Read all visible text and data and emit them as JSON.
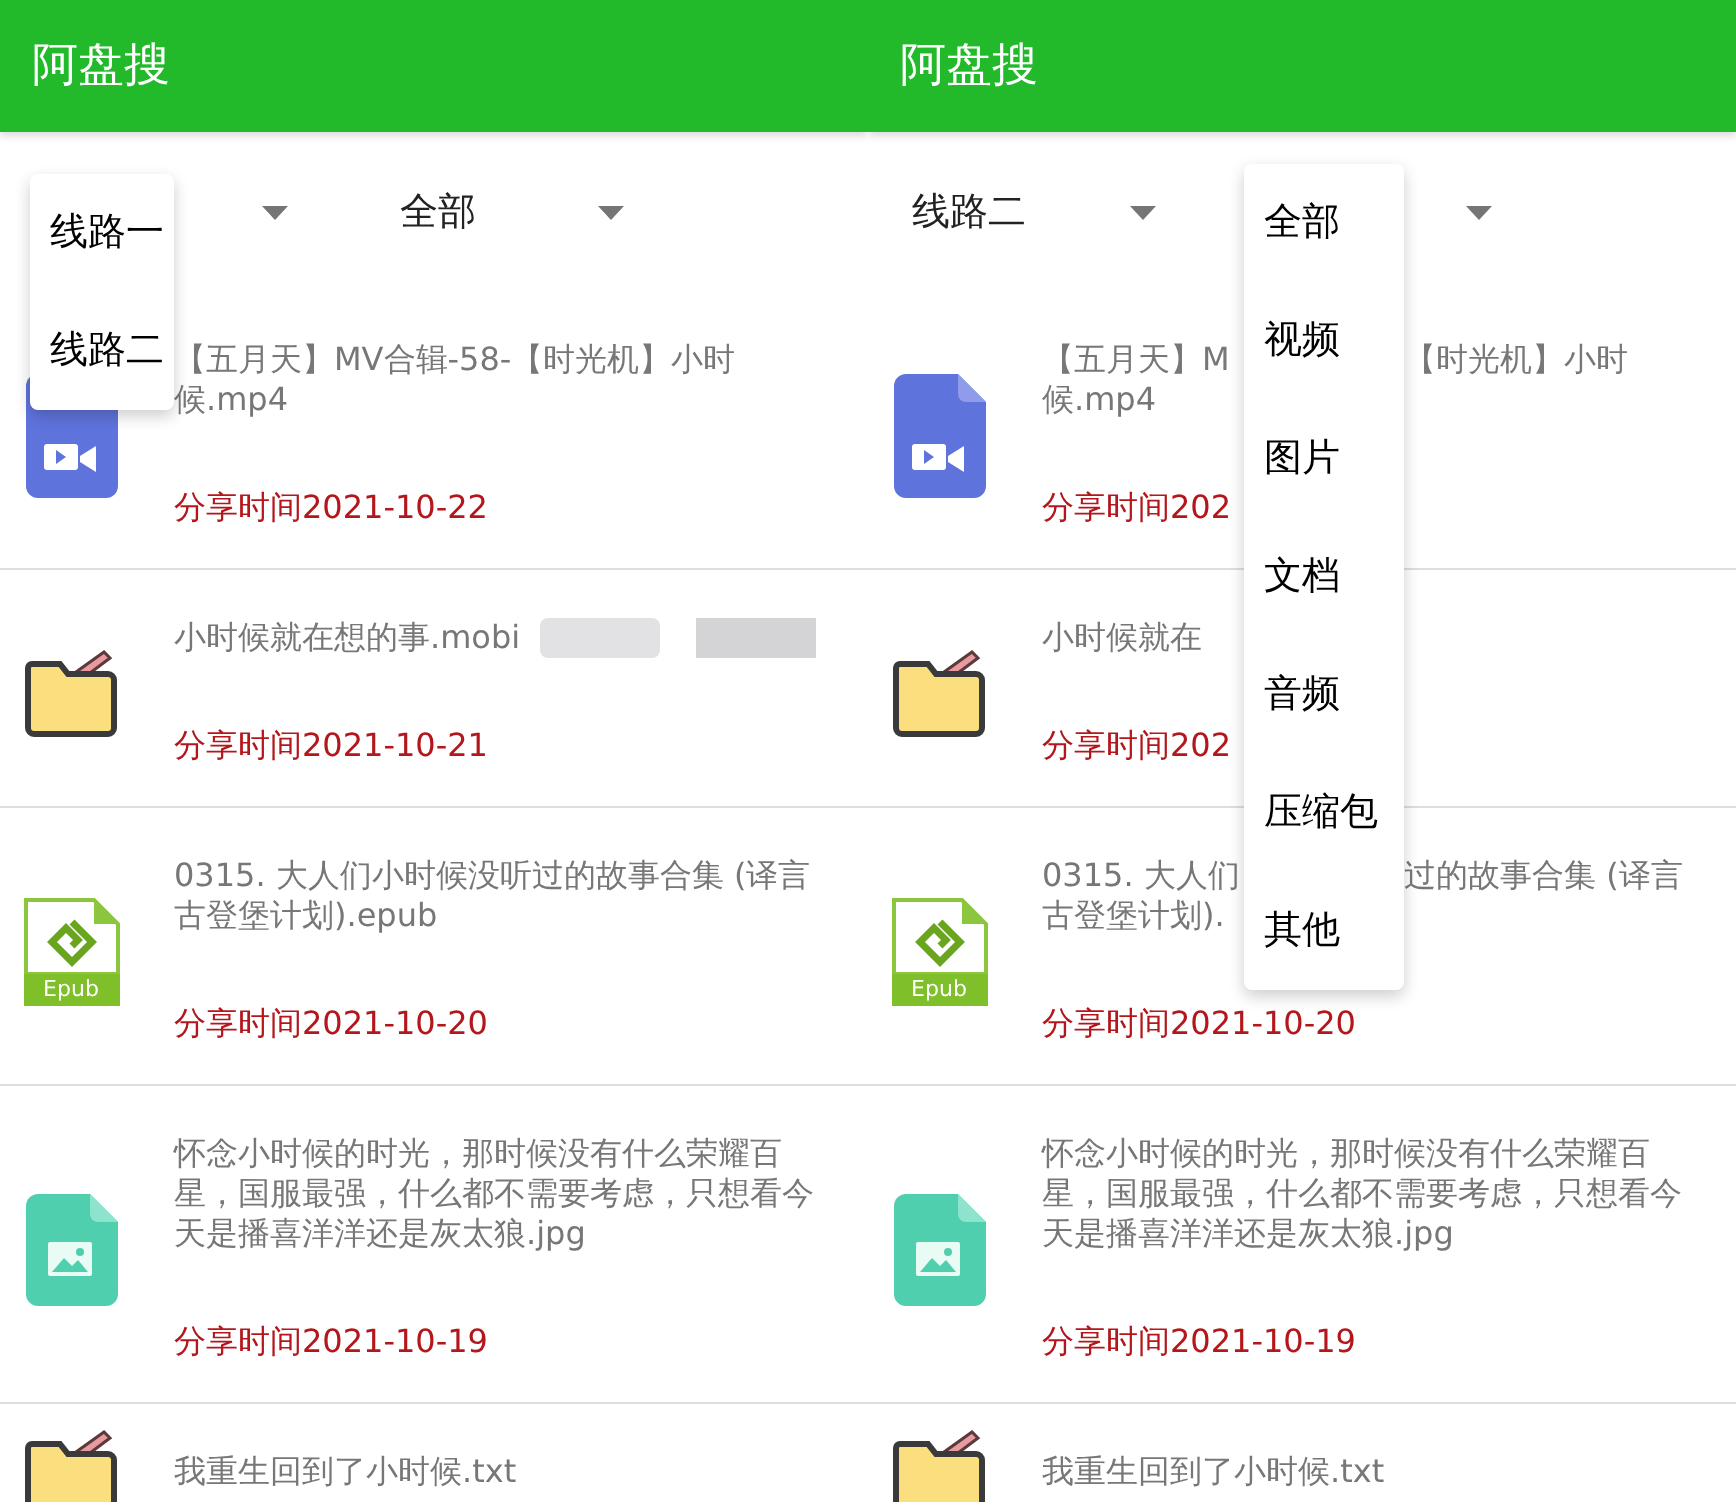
{
  "screens": [
    {
      "title": "阿盘搜",
      "filters": [
        {
          "expanded": true,
          "options": [
            "线路一",
            "线路二"
          ]
        },
        {
          "expanded": false,
          "value": "全部"
        }
      ],
      "files": [
        {
          "kind": "video",
          "title": "【五月天】MV合辑-58-【时光机】小时候.mp4",
          "date": "分享时间2021-10-22"
        },
        {
          "kind": "folder",
          "title": "小时候就在想的事.mobi",
          "redacted": true,
          "date": "分享时间2021-10-21"
        },
        {
          "kind": "epub",
          "badge": "Epub",
          "title": "0315. 大人们小时候没听过的故事合集 (译言古登堡计划).epub",
          "date": "分享时间2021-10-20"
        },
        {
          "kind": "image",
          "title": "怀念小时候的时光，那时候没有什么荣耀百星，国服最强，什么都不需要考虑，只想看今天是播喜洋洋还是灰太狼.jpg",
          "date": "分享时间2021-10-19"
        },
        {
          "kind": "folder",
          "title": "我重生回到了小时候.txt"
        }
      ]
    },
    {
      "title": "阿盘搜",
      "filters": [
        {
          "expanded": false,
          "value": "线路二"
        },
        {
          "expanded": true,
          "options": [
            "全部",
            "视频",
            "图片",
            "文档",
            "音频",
            "压缩包",
            "其他"
          ]
        }
      ],
      "files": [
        {
          "kind": "video",
          "fragments": [
            [
              "【五月天】M",
              "【时光机】小时"
            ],
            [
              "候.mp4"
            ]
          ],
          "date": "分享时间202"
        },
        {
          "kind": "folder",
          "fragments": [
            [
              "小时候就在"
            ]
          ],
          "date": "分享时间202"
        },
        {
          "kind": "epub",
          "badge": "Epub",
          "fragments": [
            [
              "0315. 大人们",
              "过的故事合集 (译言"
            ],
            [
              "古登堡计划)."
            ]
          ],
          "date": "分享时间2021-10-20"
        },
        {
          "kind": "image",
          "title": "怀念小时候的时光，那时候没有什么荣耀百星，国服最强，什么都不需要考虑，只想看今天是播喜洋洋还是灰太狼.jpg",
          "date": "分享时间2021-10-19"
        },
        {
          "kind": "folder",
          "title": "我重生回到了小时候.txt"
        }
      ]
    }
  ]
}
